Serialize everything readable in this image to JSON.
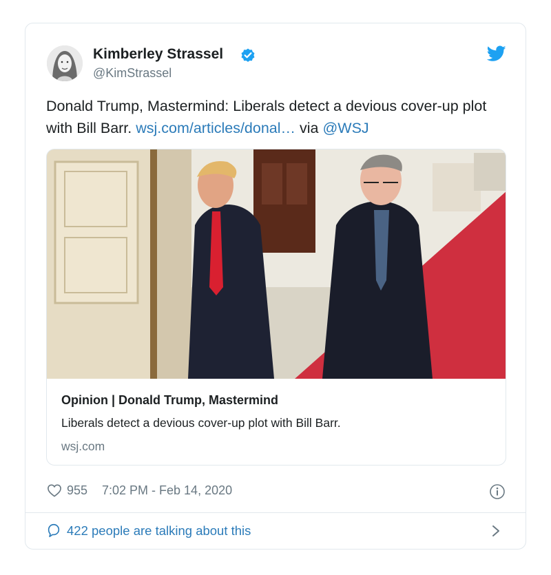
{
  "author": {
    "name": "Kimberley Strassel",
    "handle": "@KimStrassel"
  },
  "tweet": {
    "text_before": "Donald Trump, Mastermind: Liberals detect a devious cover-up plot with Bill Barr. ",
    "link": "wsj.com/articles/donal…",
    "via": " via ",
    "mention": "@WSJ"
  },
  "card": {
    "title": "Opinion | Donald Trump, Mastermind",
    "description": "Liberals detect a devious cover-up plot with Bill Barr.",
    "domain": "wsj.com"
  },
  "footer": {
    "likes": "955",
    "timestamp": "7:02 PM - Feb 14, 2020",
    "talking": "422 people are talking about this"
  },
  "icons": {
    "verified": "verified-badge-icon",
    "logo": "twitter-bird-icon",
    "like": "heart-icon",
    "info": "info-icon",
    "reply": "speech-bubble-icon",
    "more": "chevron-right-icon"
  },
  "colors": {
    "link": "#2b7bb9",
    "muted": "#697882",
    "text": "#1c2022",
    "brand": "#1da1f2",
    "border": "#e1e8ed"
  }
}
